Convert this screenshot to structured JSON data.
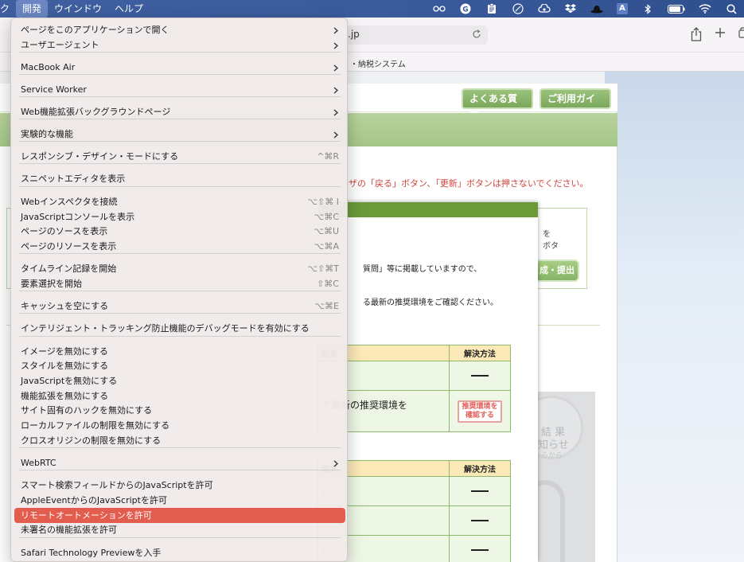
{
  "menubar": {
    "items": [
      {
        "label": "ク",
        "active": false
      },
      {
        "label": "開発",
        "active": true
      },
      {
        "label": "ウインドウ",
        "active": false
      },
      {
        "label": "ヘルプ",
        "active": false
      }
    ],
    "status_icons": [
      "glasses-icon",
      "grammarly-icon",
      "clipboard-icon",
      "feather-icon",
      "cloud-sync-icon",
      "dropbox-icon",
      "hat-icon",
      "text-input-icon",
      "bluetooth-icon",
      "battery-icon",
      "wifi-icon",
      "search-icon"
    ],
    "input_label": "A"
  },
  "toolbar": {
    "url": ".jp",
    "bookmark": "・納税システム"
  },
  "site": {
    "faq_button": "よくある質問",
    "guide_button": "ご利用ガイド",
    "warning": "ザの「戻る」ボタン、「更新」ボタンは押さないでください。",
    "side_text1": "を",
    "side_text2": "ボタ",
    "submit_button": "成・提出",
    "circle_text1": "結 果",
    "circle_text2": "知らせ",
    "circle_text3": "らから"
  },
  "modal": {
    "text1": "質問」等に掲載していますので、",
    "text2": "る最新の推奨環境をご確認ください。",
    "table_headers": [
      "結果",
      "解決方法"
    ],
    "table1_rows": [
      {
        "result": ")",
        "solution": "dash"
      },
      {
        "result": "で最新の推奨環境を",
        "result2": "。",
        "solution_label1": "推奨環境を",
        "solution_label2": "確認する"
      }
    ],
    "table2_rows": [
      {
        "result": ")"
      },
      {
        "result": ")"
      },
      {
        "result": ")"
      }
    ]
  },
  "menu": {
    "items": [
      {
        "id": "open-in-app",
        "label": "ページをこのアプリケーションで開く",
        "submenu": true,
        "shortcut": ""
      },
      {
        "id": "user-agent",
        "label": "ユーザエージェント",
        "submenu": true,
        "shortcut": ""
      },
      {
        "id": "macbook-air",
        "label": "MacBook Air",
        "submenu": true,
        "shortcut": ""
      },
      {
        "id": "service-worker",
        "label": "Service Worker",
        "submenu": true,
        "shortcut": ""
      },
      {
        "id": "web-extension-bg",
        "label": "Web機能拡張バックグラウンドページ",
        "submenu": true,
        "shortcut": ""
      },
      {
        "id": "experimental",
        "label": "実験的な機能",
        "submenu": true,
        "shortcut": ""
      },
      {
        "id": "responsive-design",
        "label": "レスポンシブ・デザイン・モードにする",
        "submenu": false,
        "shortcut": "^⌘R"
      },
      {
        "id": "snippet-editor",
        "label": "スニペットエディタを表示",
        "submenu": false,
        "shortcut": ""
      },
      {
        "id": "connect-inspector",
        "label": "Webインスペクタを接続",
        "submenu": false,
        "shortcut": "⌥⇧⌘ I"
      },
      {
        "id": "js-console",
        "label": "JavaScriptコンソールを表示",
        "submenu": false,
        "shortcut": "⌥⌘C"
      },
      {
        "id": "page-source",
        "label": "ページのソースを表示",
        "submenu": false,
        "shortcut": "⌥⌘U"
      },
      {
        "id": "page-resources",
        "label": "ページのリソースを表示",
        "submenu": false,
        "shortcut": "⌥⌘A"
      },
      {
        "id": "timeline-record",
        "label": "タイムライン記録を開始",
        "submenu": false,
        "shortcut": "⌥⇧⌘T"
      },
      {
        "id": "element-select",
        "label": "要素選択を開始",
        "submenu": false,
        "shortcut": "⇧⌘C"
      },
      {
        "id": "empty-cache",
        "label": "キャッシュを空にする",
        "submenu": false,
        "shortcut": "⌥⌘E"
      },
      {
        "id": "itp-debug",
        "label": "インテリジェント・トラッキング防止機能のデバッグモードを有効にする",
        "submenu": false,
        "shortcut": ""
      },
      {
        "id": "disable-images",
        "label": "イメージを無効にする",
        "submenu": false,
        "shortcut": ""
      },
      {
        "id": "disable-styles",
        "label": "スタイルを無効にする",
        "submenu": false,
        "shortcut": ""
      },
      {
        "id": "disable-js",
        "label": "JavaScriptを無効にする",
        "submenu": false,
        "shortcut": ""
      },
      {
        "id": "disable-extensions",
        "label": "機能拡張を無効にする",
        "submenu": false,
        "shortcut": ""
      },
      {
        "id": "disable-site-hacks",
        "label": "サイト固有のハックを無効にする",
        "submenu": false,
        "shortcut": ""
      },
      {
        "id": "disable-local-file",
        "label": "ローカルファイルの制限を無効にする",
        "submenu": false,
        "shortcut": ""
      },
      {
        "id": "disable-cors",
        "label": "クロスオリジンの制限を無効にする",
        "submenu": false,
        "shortcut": ""
      },
      {
        "id": "webrtc",
        "label": "WebRTC",
        "submenu": true,
        "shortcut": ""
      },
      {
        "id": "smart-search-js",
        "label": "スマート検索フィールドからのJavaScriptを許可",
        "submenu": false,
        "shortcut": ""
      },
      {
        "id": "appleevent-js",
        "label": "AppleEventからのJavaScriptを許可",
        "submenu": false,
        "shortcut": ""
      },
      {
        "id": "remote-automation",
        "label": "リモートオートメーションを許可",
        "submenu": false,
        "shortcut": "",
        "highlighted": true
      },
      {
        "id": "unsigned-extensions",
        "label": "未署名の機能拡張を許可",
        "submenu": false,
        "shortcut": ""
      },
      {
        "id": "safari-tp",
        "label": "Safari Technology Previewを入手",
        "submenu": false,
        "shortcut": ""
      }
    ]
  }
}
